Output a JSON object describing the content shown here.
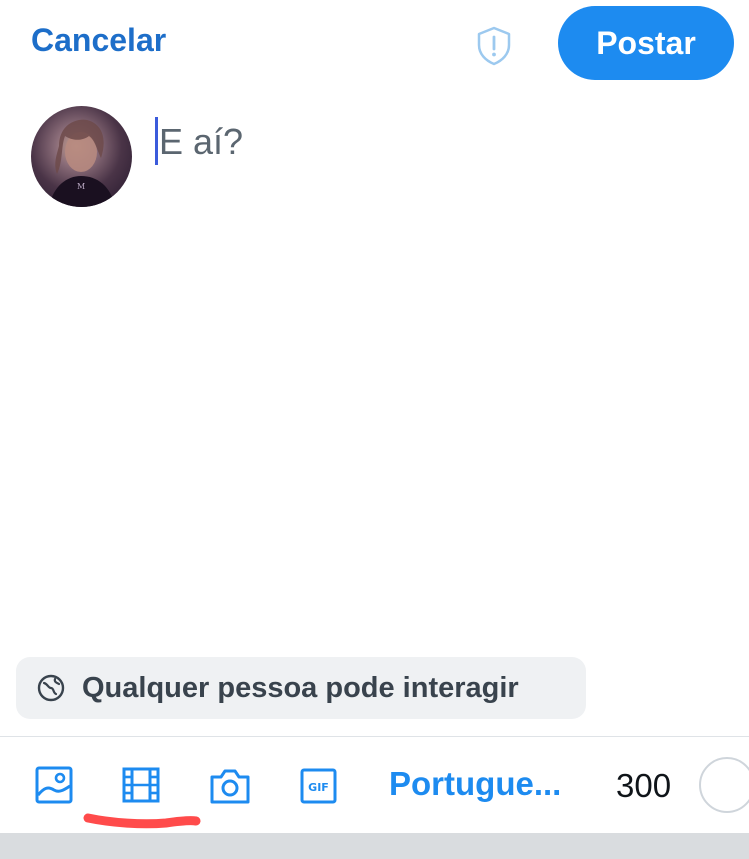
{
  "header": {
    "cancel_label": "Cancelar",
    "post_label": "Postar"
  },
  "composer": {
    "placeholder": "E aí?",
    "value": ""
  },
  "reply_setting": {
    "label": "Qualquer pessoa pode interagir"
  },
  "toolbar": {
    "language_label": "Portugue...",
    "char_count": "300"
  },
  "colors": {
    "accent": "#1d8bf0",
    "cancel_text": "#1d6ec9",
    "annotation_marker": "#ff4b4b"
  },
  "icons": {
    "shield": "shield-alert-icon",
    "image": "image-icon",
    "video": "film-icon",
    "camera": "camera-icon",
    "gif": "gif-icon",
    "reply_setting": "globe-icon"
  }
}
